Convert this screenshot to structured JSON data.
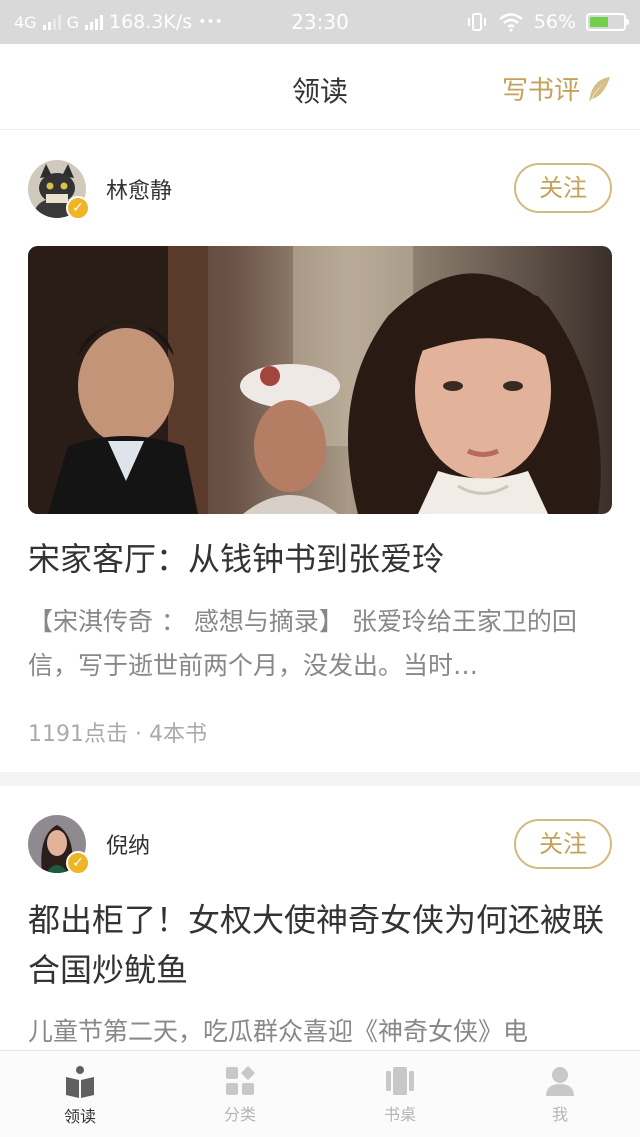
{
  "status_bar": {
    "network_1": "4G",
    "network_2": "G",
    "speed": "168.3K/s",
    "dots": "•••",
    "time": "23:30",
    "battery_percent": "56%",
    "battery_level": 0.56
  },
  "nav": {
    "title": "领读",
    "write_review": "写书评"
  },
  "feed": [
    {
      "author": "林愈静",
      "follow": "关注",
      "title": "宋家客厅：从钱钟书到张爱玲",
      "excerpt": "【宋淇传奇 ： 感想与摘录】  张爱玲给王家卫的回信，写于逝世前两个月，没发出。当时…",
      "meta": "1191点击 · 4本书"
    },
    {
      "author": "倪纳",
      "follow": "关注",
      "title": "都出柜了！女权大使神奇女侠为何还被联合国炒鱿鱼",
      "excerpt": "儿童节第二天，吃瓜群众喜迎《神奇女侠》电"
    }
  ],
  "tabs": [
    {
      "label": "领读",
      "icon": "book-open-icon",
      "active": true
    },
    {
      "label": "分类",
      "icon": "category-icon",
      "active": false
    },
    {
      "label": "书桌",
      "icon": "bookshelf-icon",
      "active": false
    },
    {
      "label": "我",
      "icon": "user-icon",
      "active": false
    }
  ],
  "colors": {
    "accent": "#c5a25a",
    "verified": "#f0b429"
  }
}
